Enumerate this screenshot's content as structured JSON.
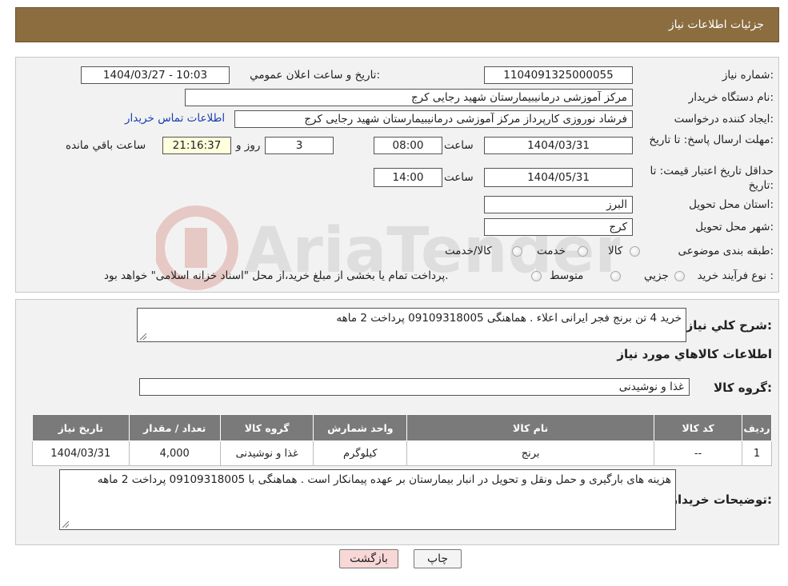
{
  "header": {
    "title": "جزئیات اطلاعات نیاز"
  },
  "form": {
    "need_number_label": "شماره نیاز:",
    "need_number": "1104091325000055",
    "announce_label": "تاريخ و ساعت اعلان عمومي:",
    "announce_value": "1404/03/27 - 10:03",
    "buyer_org_label": "نام دستگاه خريدار:",
    "buyer_org": "مرکز آموزشی درمانیبیمارستان شهید رجایی کرج",
    "requester_label": "ايجاد کننده درخواست:",
    "requester": "فرشاد نوروزی کارپرداز مرکز آموزشی درمانیبیمارستان شهید رجایی کرج",
    "contact_link": "اطلاعات تماس خريدار",
    "deadline_label": "مهلت ارسال پاسخ: تا تاريخ:",
    "deadline_date": "1404/03/31",
    "time_label": "ساعت",
    "deadline_time": "08:00",
    "days_value": "3",
    "days_label": "روز و",
    "remaining_time": "21:16:37",
    "remaining_label": "ساعت باقي مانده",
    "validity_label": "حداقل تاريخ اعتبار قيمت: تا تاريخ:",
    "validity_date": "1404/05/31",
    "validity_time": "14:00",
    "province_label": "استان محل تحويل:",
    "province": "البرز",
    "city_label": "شهر محل تحويل:",
    "city": "کرج",
    "category_label": "طبقه بندی موضوعی:",
    "category_options": [
      "کالا",
      "خدمت",
      "کالا/خدمت"
    ],
    "process_label": "نوع فرآيند خريد :",
    "process_options": [
      "جزيي",
      "متوسط"
    ],
    "process_note": "پرداخت تمام یا بخشی از مبلغ خرید،از محل \"اسناد خزانه اسلامی\" خواهد بود."
  },
  "description": {
    "label": "شرح کلي نياز:",
    "text": "خرید 4 تن  برنج  فجر  ایرانی  اعلاء  .   هماهنگی    09109318005     پرداخت  2 ماهه"
  },
  "goods": {
    "section_title": "اطلاعات کالاهاي مورد نياز",
    "group_label": "گروه کالا:",
    "group_value": "غذا و نوشیدنی"
  },
  "table": {
    "headers": [
      "رديف",
      "کد کالا",
      "نام کالا",
      "واحد شمارش",
      "گروه کالا",
      "تعداد / مقدار",
      "تاريخ نياز"
    ],
    "rows": [
      [
        "1",
        "--",
        "برنج",
        "کیلوگرم",
        "غذا و نوشیدنی",
        "4,000",
        "1404/03/31"
      ]
    ]
  },
  "buyer_notes": {
    "label": "توضيحات خريدار:",
    "text": "هزینه های بارگیری و حمل ونقل و تحویل در انبار بیمارستان بر عهده پیمانکار است . هماهنگی  با 09109318005  پرداخت 2 ماهه"
  },
  "buttons": {
    "print": "چاپ",
    "back": "بازگشت"
  },
  "watermark": {
    "text": "AriaTender.neT"
  }
}
